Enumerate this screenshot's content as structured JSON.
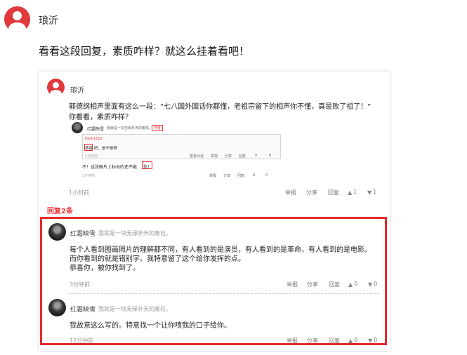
{
  "top": {
    "user_name": "琅沂",
    "post_text": "看看这段回复，素质咋样？就这么挂着看吧！"
  },
  "card": {
    "user_name": "琅沂",
    "line1": "郭德纲相声里面有这么一段：“七八国外国话你都懂，老祖宗留下的相声你不懂，真是败了祖了！”",
    "line2": "你看看，素质咋样？",
    "quote": {
      "author": "红霜映雪",
      "signature": "我就是一块无缘补天的废石。",
      "tag": "作者",
      "inner_user": "Dark1210",
      "inner_text_a": "恭喜",
      "inner_text_b": "吧，是不是啊",
      "inner_time": "5分钟前",
      "inner_actions": [
        "查看对话",
        "举报",
        "分享",
        "回复",
        "0",
        "0"
      ],
      "reply_text_a": "不！这张图片上标出的还不能",
      "reply_text_b": "你！",
      "reply_time": "2分钟前",
      "reply_actions": [
        "举报",
        "分享",
        "回复",
        "0",
        "0"
      ]
    },
    "time": "1小时前",
    "actions": {
      "report": "举报",
      "share": "分享",
      "reply": "回复",
      "like_count": "1",
      "dislike_count": "1"
    }
  },
  "replies": {
    "count_label": "回复2条",
    "items": [
      {
        "name": "红霜映雪",
        "signature": "我就是一块无缘补天的废石。",
        "lines": [
          "每个人看到图画照片的理解都不同，有人看到的是演员，有人看到的是革命，有人看到的是电影。",
          "而你看到的就是错别字。我特意留了这个给你发挥的点。",
          "恭喜你，被你找到了。"
        ],
        "time": "3分钟前",
        "report": "举报",
        "share": "分享",
        "reply": "回复",
        "like_count": "0",
        "dislike_count": "0"
      },
      {
        "name": "红霜映雪",
        "signature": "我就是一块无缘补天的废石。",
        "lines": [
          "我故意这么写的。特意找一个让你喷我的口子给你。"
        ],
        "time": "12分钟前",
        "report": "举报",
        "share": "分享",
        "reply": "回复",
        "like_count": "0",
        "dislike_count": "0"
      }
    ]
  },
  "colors": {
    "accent_red": "#e32a2a",
    "avatar_red": "#e0393b"
  }
}
